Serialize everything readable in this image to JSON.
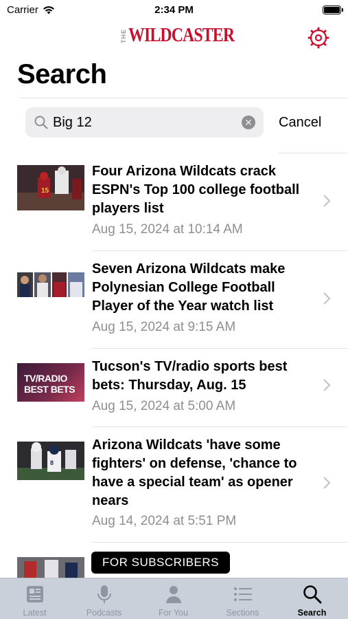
{
  "status_bar": {
    "carrier": "Carrier",
    "time": "2:34 PM"
  },
  "header": {
    "logo_the": "THE",
    "logo_name": "WILDCASTER",
    "brand_color": "#c8102e",
    "settings_icon": "settings-gear-icon"
  },
  "page": {
    "title": "Search"
  },
  "search": {
    "query": "Big 12",
    "cancel_label": "Cancel",
    "clear_icon": "clear-icon",
    "search_icon": "magnifier-icon"
  },
  "results": [
    {
      "headline": "Four Arizona Wildcats crack ESPN's Top 100 college football players list",
      "date": "Aug 15, 2024 at 10:14 AM"
    },
    {
      "headline": "Seven Arizona Wildcats make Polynesian College Football Player of the Year watch list",
      "date": "Aug 15, 2024 at 9:15 AM"
    },
    {
      "headline": "Tucson's TV/radio sports best bets: Thursday, Aug. 15",
      "date": "Aug 15, 2024 at 5:00 AM",
      "thumb_text_1": "TV/RADIO",
      "thumb_text_2": "BEST BETS"
    },
    {
      "headline": "Arizona Wildcats 'have some fighters' on defense, 'chance to have a special team' as opener nears",
      "date": "Aug 14, 2024 at 5:51 PM"
    }
  ],
  "subscriber_badge": "FOR SUBSCRIBERS",
  "tabbar": {
    "tabs": [
      {
        "label": "Latest",
        "icon": "newspaper-icon"
      },
      {
        "label": "Podcasts",
        "icon": "microphone-icon"
      },
      {
        "label": "For You",
        "icon": "person-icon"
      },
      {
        "label": "Sections",
        "icon": "list-icon"
      },
      {
        "label": "Search",
        "icon": "magnifier-icon"
      }
    ],
    "active": "Search"
  }
}
